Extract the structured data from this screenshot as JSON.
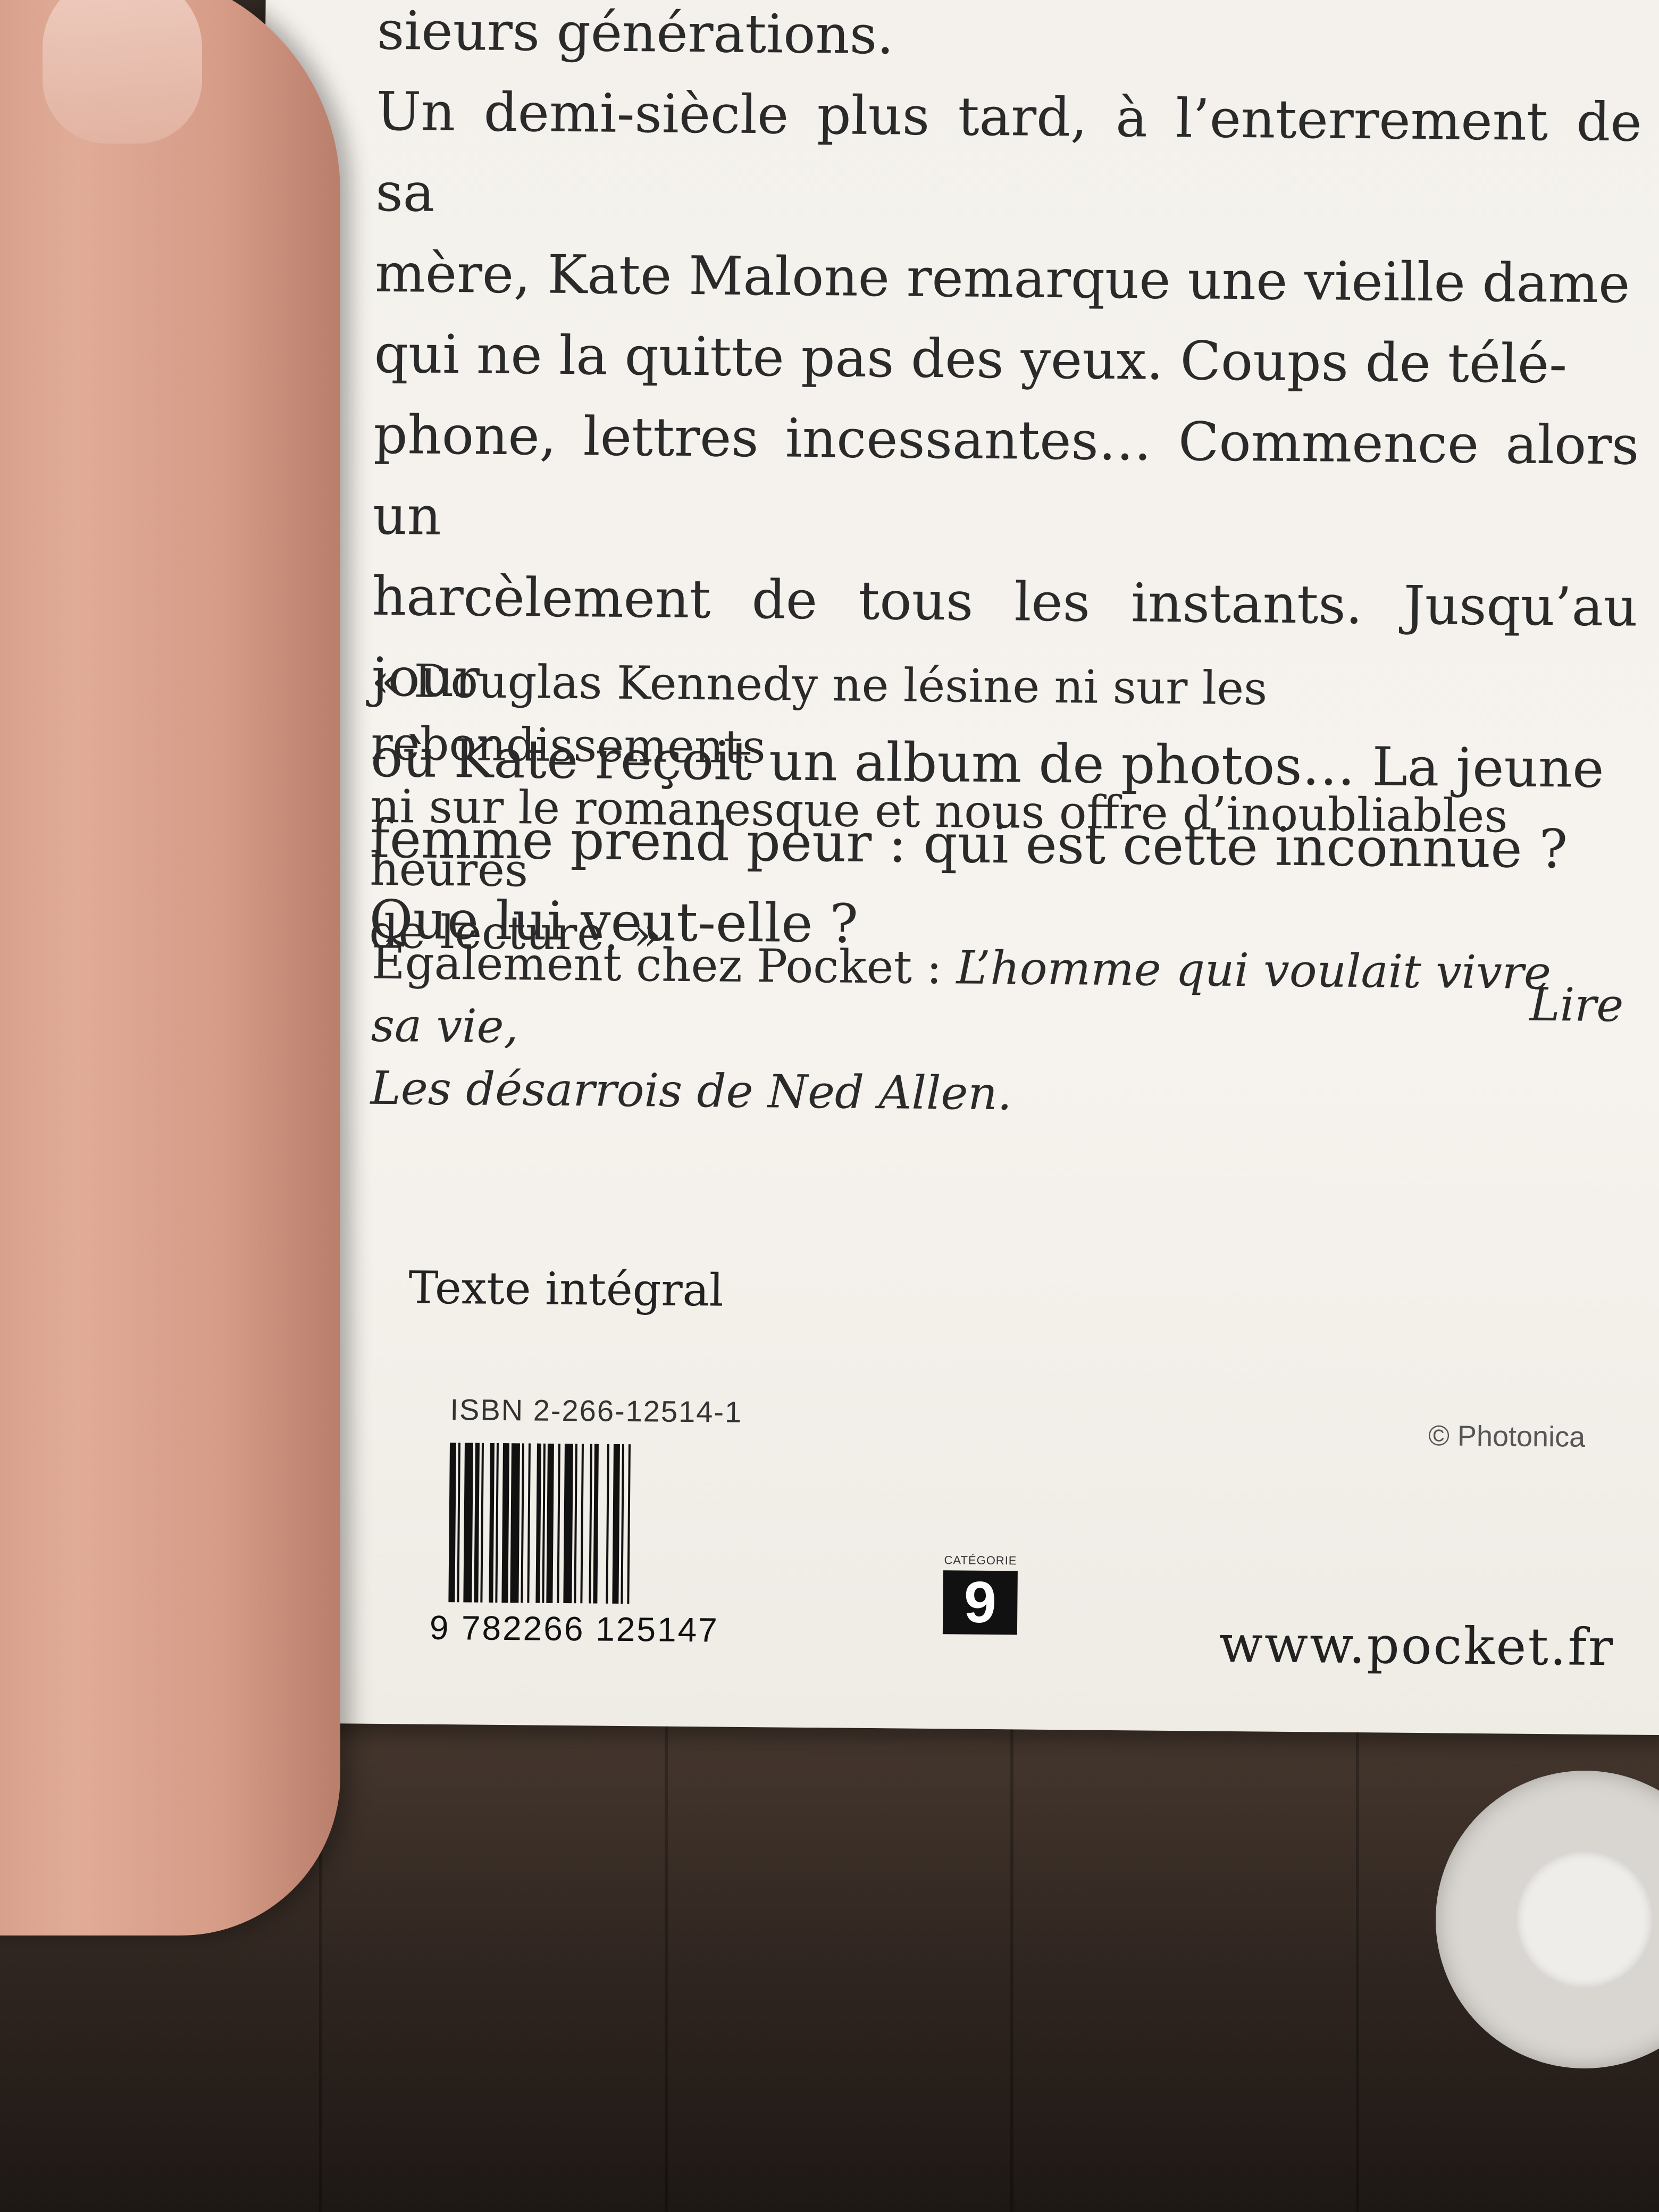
{
  "book_back_cover": {
    "synopsis_lines": [
      "sieurs générations.",
      "Un demi-siècle plus tard, à l’enterrement de sa",
      "mère, Kate Malone remarque une vieille dame",
      "qui ne la quitte pas des yeux. Coups de télé-",
      "phone, lettres incessantes… Commence alors un",
      "harcèlement de tous les instants. Jusqu’au jour",
      "où Kate reçoit un album de photos… La jeune",
      "femme prend peur : qui est cette inconnue ?",
      "Que lui veut-elle ?"
    ],
    "quote_lines": [
      "« Douglas Kennedy ne lésine ni sur les rebondissements",
      "ni sur le romanesque et nous offre d’inoubliables heures",
      "de lecture. »"
    ],
    "quote_source": "Lire",
    "also_prefix": "Également chez Pocket : ",
    "also_titles_line1": "L’homme qui voulait vivre sa vie,",
    "also_titles_line2": "Les désarrois de Ned Allen.",
    "integral": "Texte intégral",
    "isbn": "ISBN 2-266-12514-1",
    "credit": "© Photonica",
    "barcode_digits": {
      "first": "9",
      "rest": "782266 125147"
    },
    "category_label": "CATÉGORIE",
    "category_number": "9",
    "website": "www.pocket.fr"
  }
}
